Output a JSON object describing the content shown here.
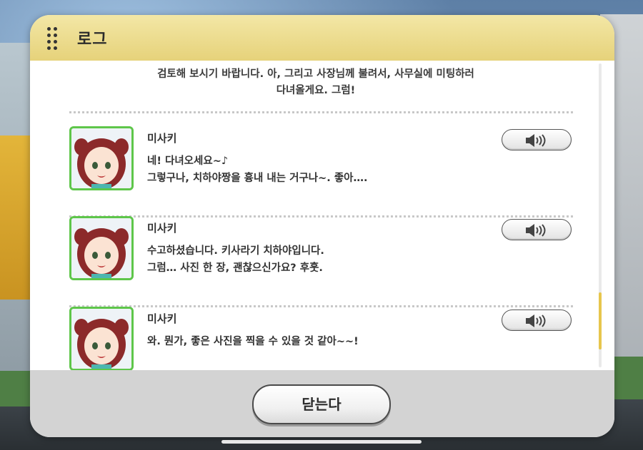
{
  "header": {
    "title": "로그"
  },
  "log": {
    "previous_text": "검토해 보시기 바랍니다. 아, 그리고 사장님께 불려서, 사무실에 미팅하러\n다녀올게요. 그럼!",
    "entries": [
      {
        "speaker": "미사키",
        "lines": [
          "네! 다녀오세요~♪",
          "그렇구나, 치하야짱을 흉내 내는 거구나~. 좋아…."
        ]
      },
      {
        "speaker": "미사키",
        "lines": [
          "수고하셨습니다. 키사라기 치하야입니다.",
          "그럼… 사진 한 장, 괜찮으신가요? 후훗."
        ]
      },
      {
        "speaker": "미사키",
        "lines": [
          "와. 뭔가, 좋은 사진을 찍을 수 있을 것 같아~~!"
        ]
      }
    ],
    "voice_icon": "speaker-icon"
  },
  "footer": {
    "close_label": "닫는다"
  },
  "colors": {
    "header_gradient_top": "#f3e7a6",
    "header_gradient_bottom": "#e6d27a",
    "portrait_border": "#5ec64a",
    "scroll_thumb": "#e7c64d"
  }
}
